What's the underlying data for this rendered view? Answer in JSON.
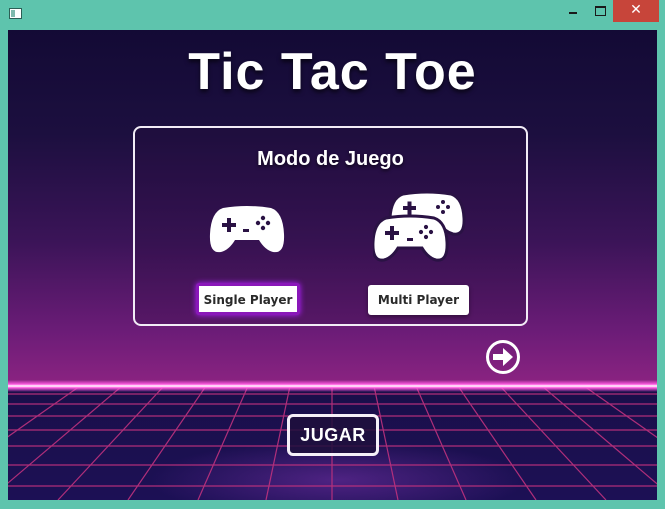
{
  "window": {
    "minimize_icon": "minimize-icon",
    "maximize_icon": "maximize-icon",
    "close_symbol": "✕"
  },
  "title": "Tic Tac Toe",
  "panel": {
    "title": "Modo de Juego",
    "single_player_label": "Single Player",
    "multi_player_label": "Multi Player",
    "single_icon": "gamepad-icon",
    "multi_icon": "gamepads-icon"
  },
  "next_icon": "arrow-right-circle-icon",
  "play_label": "JUGAR",
  "colors": {
    "window_frame": "#5ec4ad",
    "close_button": "#c7453a",
    "selected_border": "#8a17b9",
    "horizon_glow": "#ff58e0",
    "grid_line": "#c0327e"
  }
}
